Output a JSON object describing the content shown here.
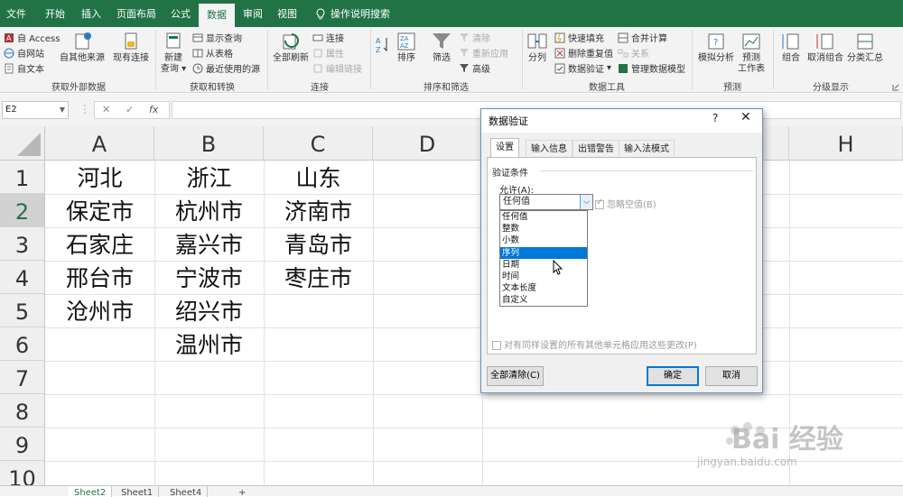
{
  "tabs": [
    "文件",
    "开始",
    "插入",
    "页面布局",
    "公式",
    "数据",
    "审阅",
    "视图",
    "操作说明搜索"
  ],
  "active_tab": "数据",
  "ribbon": {
    "ext_data": {
      "access": "自 Access",
      "web": "自网站",
      "text": "自文本",
      "other": "自其他来源",
      "existing": "现有连接",
      "group": "获取外部数据"
    },
    "transform": {
      "new_query": "新建",
      "new_query2": "查询",
      "show_query": "显示查询",
      "from_table": "从表格",
      "recent": "最近使用的源",
      "group": "获取和转换"
    },
    "connections": {
      "refresh_all": "全部刷新",
      "connections": "连接",
      "properties": "属性",
      "edit_links": "编辑链接",
      "group": "连接"
    },
    "sort_filter": {
      "sort": "排序",
      "filter": "筛选",
      "clear": "清除",
      "reapply": "重新应用",
      "advanced": "高级",
      "group": "排序和筛选"
    },
    "data_tools": {
      "split": "分列",
      "flash_fill": "快速填充",
      "remove_dup": "删除重复值",
      "validation": "数据验证",
      "consolidate": "合并计算",
      "relations": "关系",
      "manage_model": "管理数据模型",
      "group": "数据工具"
    },
    "forecast": {
      "what_if": "模拟分析",
      "sheet": "预测",
      "sheet2": "工作表",
      "group": "预测"
    },
    "outline": {
      "group_btn": "组合",
      "ungroup": "取消组合",
      "subtotal": "分类汇总",
      "group": "分级显示"
    }
  },
  "formula_bar": {
    "name_box": "E2",
    "cancel": "✕",
    "enter": "✓",
    "fx": "fx"
  },
  "columns": [
    "A",
    "B",
    "C",
    "D",
    "H"
  ],
  "rows": [
    "1",
    "2",
    "3",
    "4",
    "5",
    "6",
    "7",
    "8",
    "9",
    "10"
  ],
  "cells": {
    "A1": "河北",
    "B1": "浙江",
    "C1": "山东",
    "A2": "保定市",
    "B2": "杭州市",
    "C2": "济南市",
    "A3": "石家庄",
    "B3": "嘉兴市",
    "C3": "青岛市",
    "A4": "邢台市",
    "B4": "宁波市",
    "C4": "枣庄市",
    "A5": "沧州市",
    "B5": "绍兴市",
    "B6": "温州市"
  },
  "sheets": [
    "Sheet2",
    "Sheet1",
    "Sheet4"
  ],
  "active_sheet": "Sheet2",
  "add_sheet": "+",
  "dialog": {
    "title": "数据验证",
    "help": "?",
    "close": "✕",
    "tabs": [
      "设置",
      "输入信息",
      "出错警告",
      "输入法模式"
    ],
    "section": "验证条件",
    "allow_label": "允许(A):",
    "allow_value": "任何值",
    "ignore_blank": "忽略空值(B)",
    "options": [
      "任何值",
      "整数",
      "小数",
      "序列",
      "日期",
      "时间",
      "文本长度",
      "自定义"
    ],
    "highlighted_option": "序列",
    "apply_all": "对有同样设置的所有其他单元格应用这些更改(P)",
    "clear_all": "全部清除(C)",
    "ok": "确定",
    "cancel": "取消"
  },
  "watermark": {
    "brand": "Bai 经验",
    "url": "jingyan.baidu.com"
  },
  "colors": {
    "accent": "#217346",
    "selection": "#0078d7"
  }
}
